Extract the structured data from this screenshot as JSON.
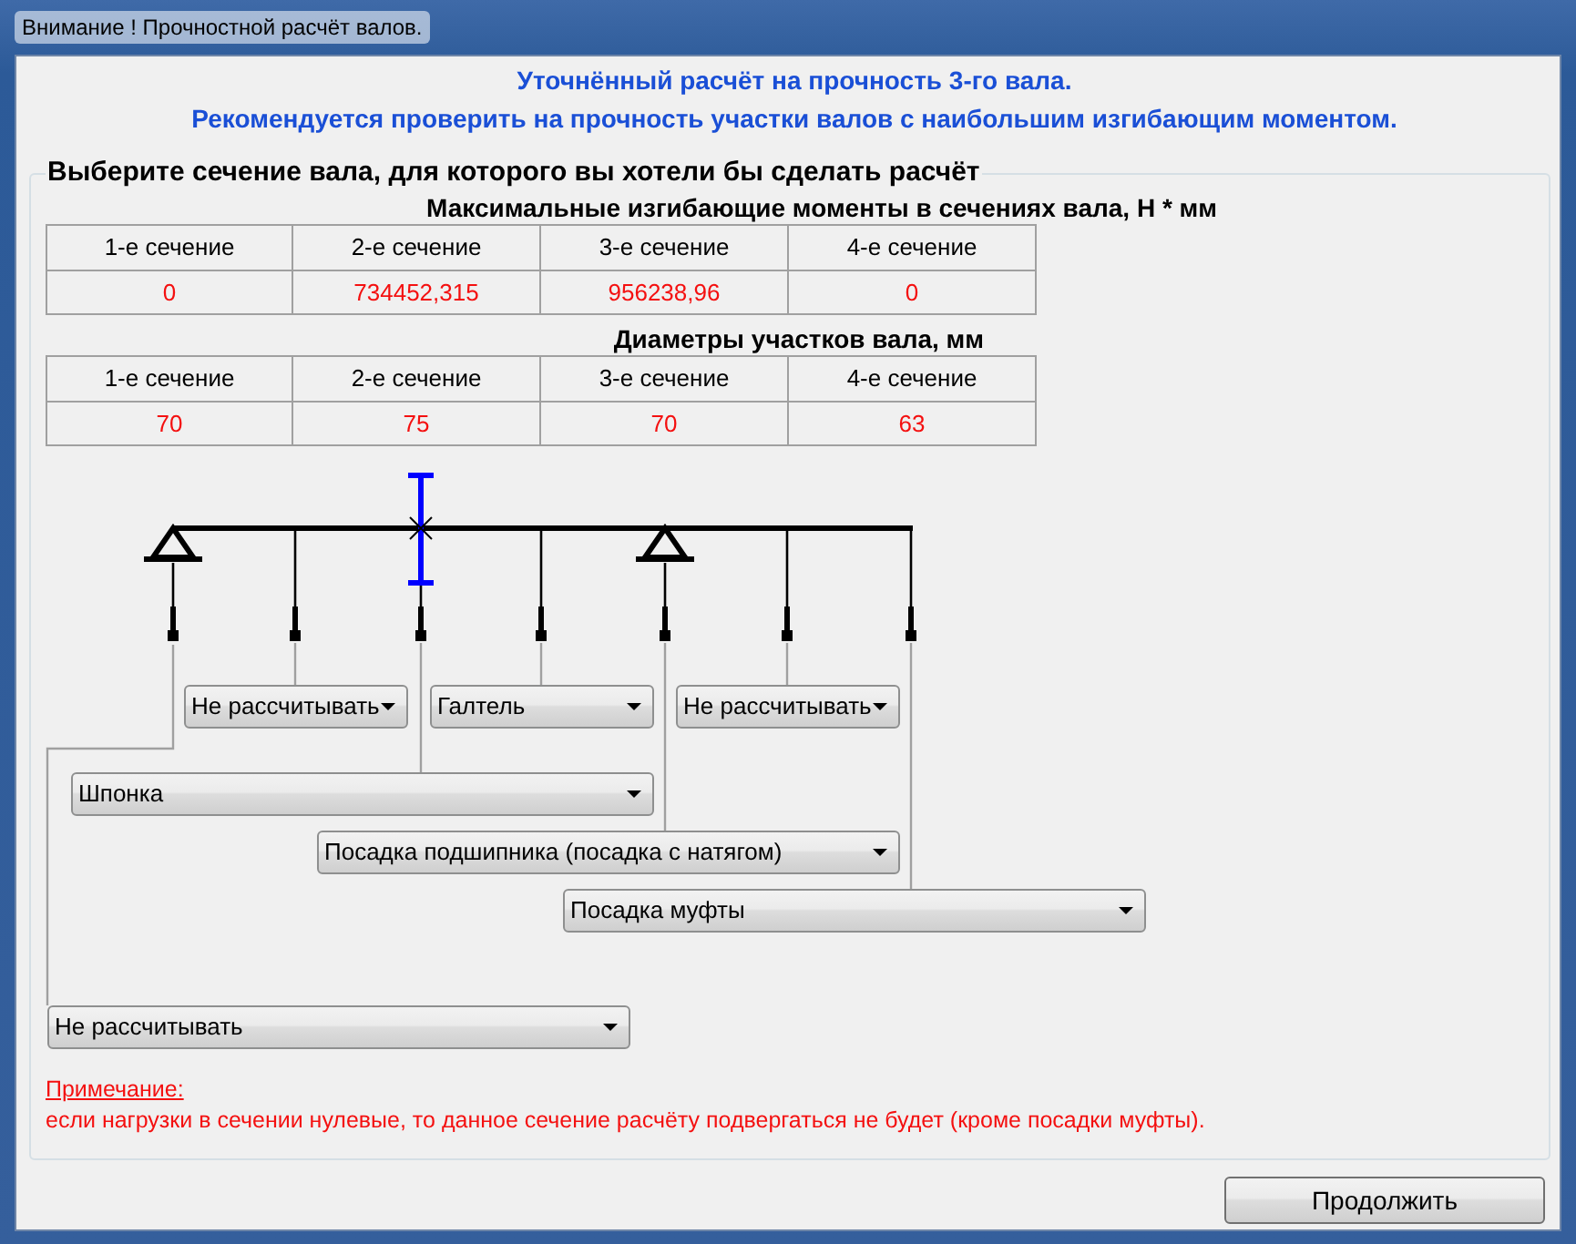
{
  "window": {
    "title": "Внимание ! Прочностной расчёт валов."
  },
  "header": {
    "lines": [
      "Уточнённый расчёт на прочность 3-го вала.",
      "Рекомендуется проверить на прочность участки валов с наибольшим изгибающим моментом."
    ]
  },
  "group": {
    "legend": "Выберите сечение вала, для которого вы хотели бы сделать расчёт"
  },
  "tables": [
    {
      "title": "Максимальные изгибающие моменты в сечениях вала, Н * мм",
      "columns": [
        "1-е сечение",
        "2-е сечение",
        "3-е сечение",
        "4-е сечение"
      ],
      "values": [
        "0",
        "734452,315",
        "956238,96",
        "0"
      ]
    },
    {
      "title": "Диаметры участков вала, мм",
      "columns": [
        "1-е сечение",
        "2-е сечение",
        "3-е сечение",
        "4-е сечение"
      ],
      "values": [
        "70",
        "75",
        "70",
        "63"
      ]
    }
  ],
  "shaft": {
    "stations": [
      {
        "kind": "support",
        "selected": false,
        "option": "Не рассчитывать"
      },
      {
        "kind": "point",
        "selected": false,
        "option": "Не рассчитывать"
      },
      {
        "kind": "point",
        "selected": true,
        "option": "Шпонка"
      },
      {
        "kind": "point",
        "selected": false,
        "option": "Галтель"
      },
      {
        "kind": "support",
        "selected": false,
        "option": "Посадка подшипника (посадка с натягом)"
      },
      {
        "kind": "point",
        "selected": false,
        "option": "Не рассчитывать"
      },
      {
        "kind": "point",
        "selected": false,
        "option": "Посадка муфты"
      }
    ]
  },
  "note": {
    "label": "Примечание:",
    "text": "если нагрузки в сечении нулевые, то данное сечение расчёту подвергаться не будет (кроме посадки муфты)."
  },
  "buttons": [
    "Продолжить"
  ]
}
